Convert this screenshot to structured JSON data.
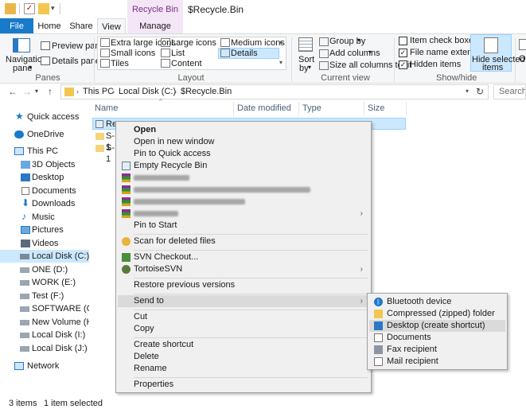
{
  "titlebar": {
    "contextual_tab_title": "Recycle Bin Tools",
    "window_title": "$Recycle.Bin"
  },
  "tabs": {
    "file": "File",
    "home": "Home",
    "share": "Share",
    "view": "View",
    "manage": "Manage"
  },
  "ribbon": {
    "panes": {
      "navigation_pane": "Navigation",
      "navigation_pane_2": "pane",
      "preview_pane": "Preview pane",
      "details_pane": "Details pane",
      "label": "Panes"
    },
    "layout": {
      "extra_large_icons": "Extra large icons",
      "large_icons": "Large icons",
      "medium_icons": "Medium icons",
      "small_icons": "Small icons",
      "list": "List",
      "details": "Details",
      "tiles": "Tiles",
      "content": "Content",
      "label": "Layout"
    },
    "current_view": {
      "sort_by": "Sort",
      "sort_by_2": "by",
      "group_by": "Group by",
      "add_columns": "Add columns",
      "size_all_columns": "Size all columns to fit",
      "label": "Current view"
    },
    "show_hide": {
      "item_check_boxes": "Item check boxes",
      "file_name_extensions": "File name extensions",
      "hidden_items": "Hidden items",
      "hide_selected": "Hide selected",
      "hide_selected_2": "items",
      "label": "Show/hide",
      "options_partial": "Op"
    }
  },
  "address": {
    "this_pc": "This PC",
    "local_disk": "Local Disk (C:)",
    "folder": "$Recycle.Bin",
    "search_placeholder": "Search $R"
  },
  "nav": {
    "quick_access": "Quick access",
    "onedrive": "OneDrive",
    "this_pc": "This PC",
    "objects_3d": "3D Objects",
    "desktop": "Desktop",
    "documents": "Documents",
    "downloads": "Downloads",
    "music": "Music",
    "pictures": "Pictures",
    "videos": "Videos",
    "local_disk_c": "Local Disk (C:)",
    "one_d": "ONE (D:)",
    "work_e": "WORK (E:)",
    "test_f": "Test (F:)",
    "software_g": "SOFTWARE (G:)",
    "new_volume_h": "New Volume (H:)",
    "local_disk_i": "Local Disk (I:)",
    "local_disk_j": "Local Disk (J:)",
    "network": "Network"
  },
  "filelist": {
    "columns": {
      "name": "Name",
      "date_modified": "Date modified",
      "type": "Type",
      "size": "Size"
    },
    "rows": [
      "Rec",
      "S-1",
      "S-1"
    ]
  },
  "status": {
    "items": "3 items",
    "selected": "1 item selected"
  },
  "context_menu": {
    "open": "Open",
    "open_new_window": "Open in new window",
    "pin_quick_access": "Pin to Quick access",
    "empty_recycle_bin": "Empty Recycle Bin",
    "pin_to_start": "Pin to Start",
    "scan_deleted": "Scan for deleted files",
    "svn_checkout": "SVN Checkout...",
    "tortoise_svn": "TortoiseSVN",
    "restore_versions": "Restore previous versions",
    "send_to": "Send to",
    "cut": "Cut",
    "copy": "Copy",
    "create_shortcut": "Create shortcut",
    "delete": "Delete",
    "rename": "Rename",
    "properties": "Properties"
  },
  "send_to_menu": {
    "bluetooth": "Bluetooth device",
    "compressed": "Compressed (zipped) folder",
    "desktop": "Desktop (create shortcut)",
    "documents": "Documents",
    "fax": "Fax recipient",
    "mail": "Mail recipient"
  },
  "colors": {
    "accent": "#1979ca",
    "contextual_tab": "#f4e6f6",
    "selection": "#cce8ff",
    "menu_bg": "#f0f0f0",
    "menu_highlight": "#dadada"
  }
}
